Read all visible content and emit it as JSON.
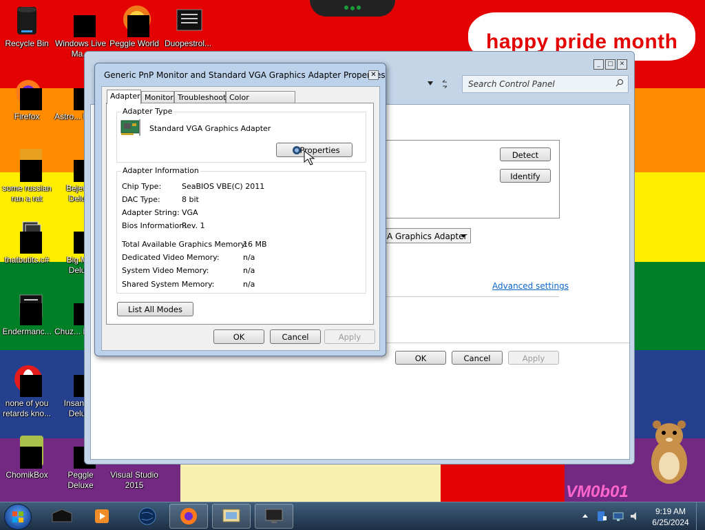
{
  "desktop": {
    "banner_text": "happy pride month",
    "watermark": "VM0b01",
    "icons": [
      {
        "label": "Recycle Bin"
      },
      {
        "label": "Windows Live Ma..."
      },
      {
        "label": "Peggle World"
      },
      {
        "label": "Duopestrol..."
      },
      {
        "label": "Firefox"
      },
      {
        "label": "Astro... Delu..."
      },
      {
        "label": "some russian ran a rat"
      },
      {
        "label": "Bejew... Delu..."
      },
      {
        "label": "thatbutits.c#"
      },
      {
        "label": "Big M... Delu..."
      },
      {
        "label": "Endermanc..."
      },
      {
        "label": "Chuz... Delu..."
      },
      {
        "label": "none of you retards kno..."
      },
      {
        "label": "Insaniq... Delu..."
      },
      {
        "label": "ChomikBox"
      },
      {
        "label": "Peggle Deluxe"
      },
      {
        "label": "Visual Studio 2015"
      }
    ]
  },
  "control_panel": {
    "search_placeholder": "Search Control Panel",
    "detect_label": "Detect",
    "identify_label": "Identify",
    "display_combo": "A Graphics Adapter",
    "advanced_settings": "Advanced settings",
    "ok_label": "OK",
    "cancel_label": "Cancel",
    "apply_label": "Apply"
  },
  "dialog": {
    "title": "Generic PnP Monitor and Standard VGA Graphics Adapter Properties",
    "close_glyph": "✕",
    "tabs": [
      {
        "label": "Adapter",
        "active": true
      },
      {
        "label": "Monitor"
      },
      {
        "label": "Troubleshoot"
      },
      {
        "label": "Color Management"
      }
    ],
    "adapter_type": {
      "legend": "Adapter Type",
      "name": "Standard VGA Graphics Adapter",
      "properties_label": "Properties"
    },
    "adapter_info": {
      "legend": "Adapter Information",
      "rows": [
        {
          "label": "Chip Type:",
          "value": "SeaBIOS VBE(C) 2011"
        },
        {
          "label": "DAC Type:",
          "value": "8 bit"
        },
        {
          "label": "Adapter String:",
          "value": "VGA"
        },
        {
          "label": "Bios Information:",
          "value": "Rev. 1"
        }
      ],
      "memory_rows": [
        {
          "label": "Total Available Graphics Memory:",
          "value": "16 MB"
        },
        {
          "label": "Dedicated Video Memory:",
          "value": "n/a"
        },
        {
          "label": "System Video Memory:",
          "value": "n/a"
        },
        {
          "label": "Shared System Memory:",
          "value": "n/a"
        }
      ]
    },
    "list_all_modes": "List All Modes",
    "ok_label": "OK",
    "cancel_label": "Cancel",
    "apply_label": "Apply"
  },
  "taskbar": {
    "time": "9:19 AM",
    "date": "6/25/2024",
    "items": [
      {
        "icon": "media-center-icon"
      },
      {
        "icon": "media-player-icon"
      },
      {
        "icon": "globe-icon"
      },
      {
        "icon": "firefox-icon"
      },
      {
        "icon": "control-panel-icon"
      },
      {
        "icon": "display-properties-icon"
      }
    ]
  }
}
